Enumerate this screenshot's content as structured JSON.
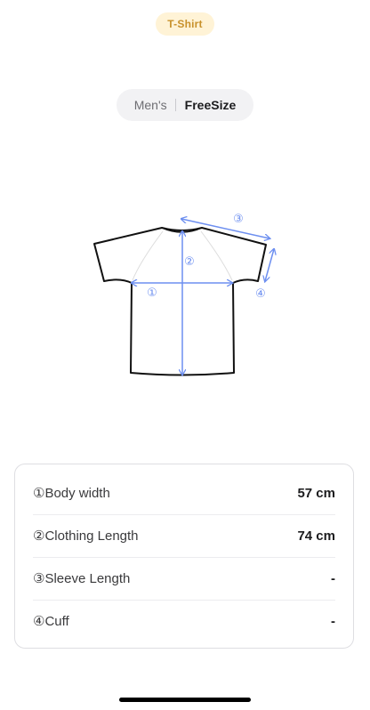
{
  "header": {
    "category_badge": "T-Shirt"
  },
  "size_selector": {
    "gender": "Men's",
    "selected_size": "FreeSize"
  },
  "diagram": {
    "markers": {
      "body_width": "①",
      "clothing_length": "②",
      "sleeve_length": "③",
      "cuff": "④"
    },
    "colors": {
      "outline": "#111111",
      "measure_line": "#6d8ff0",
      "seam": "#dcdcdc"
    }
  },
  "measurements": [
    {
      "label": "①Body width",
      "value": "57 cm"
    },
    {
      "label": "②Clothing Length",
      "value": "74 cm"
    },
    {
      "label": "③Sleeve Length",
      "value": "-"
    },
    {
      "label": "④Cuff",
      "value": "-"
    }
  ],
  "colors": {
    "badge_background": "#fff3d6",
    "badge_text": "#c8912b",
    "selector_background": "#f2f2f4"
  }
}
